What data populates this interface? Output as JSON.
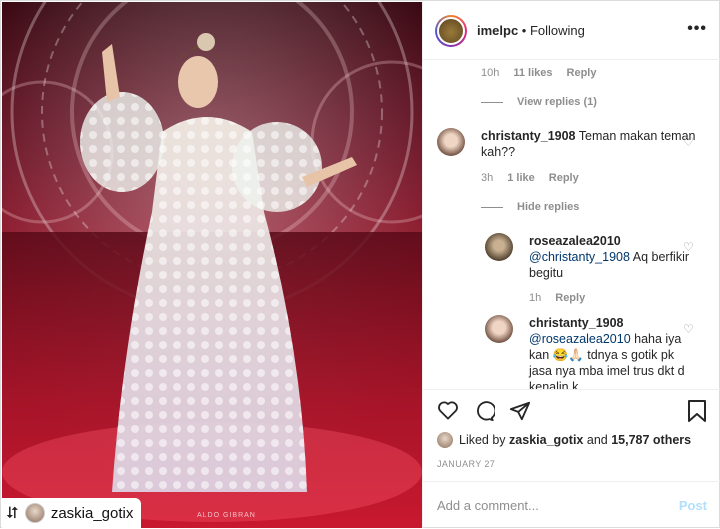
{
  "photo": {
    "repost_icon": "repost-icon",
    "repost_user": "zaskia_gotix",
    "watermark": "ALDO GIBRAN"
  },
  "header": {
    "username": "imelpc",
    "separator": " • ",
    "follow_status": "Following",
    "more_icon": "more-options-icon",
    "more_glyph": "•••"
  },
  "comments": {
    "top_meta": {
      "time": "10h",
      "likes": "11 likes",
      "reply": "Reply"
    },
    "view_replies": "View replies (1)",
    "items": [
      {
        "username": "christanty_1908",
        "text": "Teman makan teman kah??",
        "time": "3h",
        "likes": "1 like",
        "reply": "Reply",
        "hide_replies": "Hide replies"
      },
      {
        "username": "roseazalea2010",
        "mention": "@christanty_1908",
        "text": " Aq berfikir begitu",
        "time": "1h",
        "reply": "Reply"
      },
      {
        "username": "christanty_1908",
        "mention": "@roseazalea2010",
        "text": " haha iya kan 😂🙏🏻 tdnya s gotik pk jasa nya mba imel trus dkt d kenalin k"
      }
    ]
  },
  "actions": {
    "like_icon": "heart-icon",
    "comment_icon": "comment-icon",
    "share_icon": "share-icon",
    "save_icon": "bookmark-icon",
    "liked_by_prefix": "Liked by ",
    "liked_by_user": "zaskia_gotix",
    "liked_by_mid": " and ",
    "liked_by_count": "15,787 others",
    "date": "JANUARY 27",
    "comment_placeholder": "Add a comment...",
    "post_label": "Post"
  }
}
